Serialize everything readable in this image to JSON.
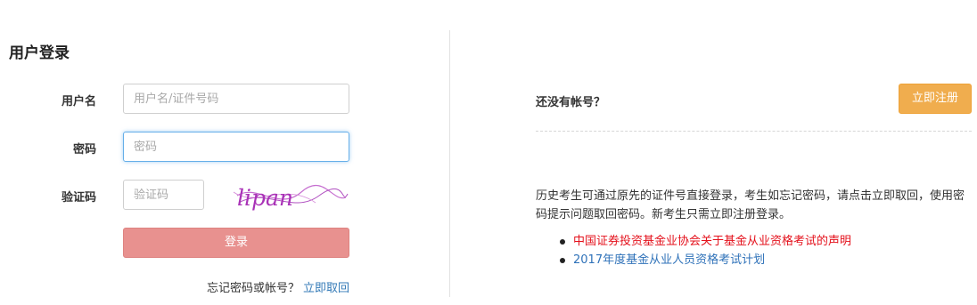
{
  "login": {
    "title": "用户登录",
    "username_label": "用户名",
    "username_placeholder": "用户名/证件号码",
    "password_label": "密码",
    "password_placeholder": "密码",
    "captcha_label": "验证码",
    "captcha_placeholder": "验证码",
    "captcha_image_text": "lipan",
    "submit_label": "登录",
    "forgot_text": "忘记密码或帐号？",
    "forgot_link": "立即取回"
  },
  "register": {
    "prompt": "还没有帐号？",
    "button_label": "立即注册",
    "notice": "历史考生可通过原先的证件号直接登录，考生如忘记密码，请点击立即取回，使用密码提示问题取回密码。新考生只需立即注册登录。",
    "links": [
      {
        "text": "中国证券投资基金业协会关于基金从业资格考试的声明",
        "color": "#e4101b"
      },
      {
        "text": "2017年度基金从业人员资格考试计划",
        "color": "#2f72b9"
      }
    ]
  },
  "colors": {
    "login_button": "#e8918f",
    "register_button": "#f0ad4e",
    "link_blue": "#337ab7",
    "focus_border": "#66afe9"
  }
}
